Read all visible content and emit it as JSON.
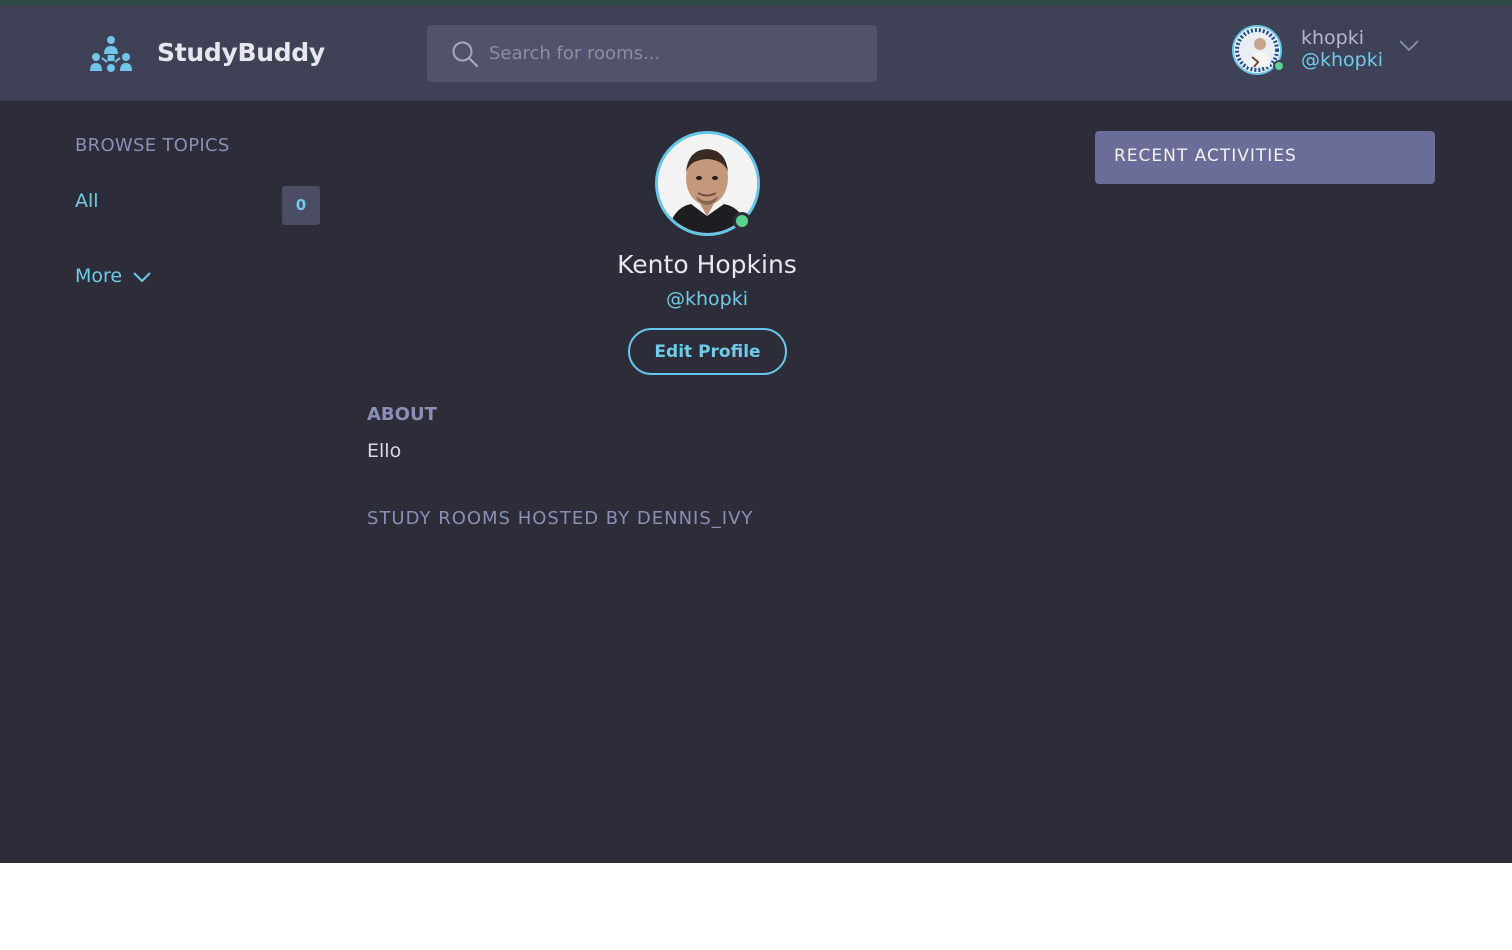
{
  "header": {
    "brand": "StudyBuddy",
    "search_placeholder": "Search for rooms...",
    "user": {
      "name": "khopki",
      "handle": "@khopki",
      "online": true
    }
  },
  "sidebar": {
    "title": "BROWSE TOPICS",
    "topics": [
      {
        "label": "All",
        "count": "0"
      }
    ],
    "more_label": "More"
  },
  "profile": {
    "name": "Kento Hopkins",
    "handle": "@khopki",
    "edit_label": "Edit Profile",
    "about_title": "ABOUT",
    "about_text": "Ello",
    "rooms_title": "STUDY ROOMS HOSTED BY DENNIS_IVY"
  },
  "activity": {
    "title": "RECENT ACTIVITIES"
  },
  "colors": {
    "background": "#2d2d39",
    "header": "#3f4156",
    "accent": "#6fcbe8",
    "online": "#5cd190",
    "activity_header": "#696d97"
  }
}
